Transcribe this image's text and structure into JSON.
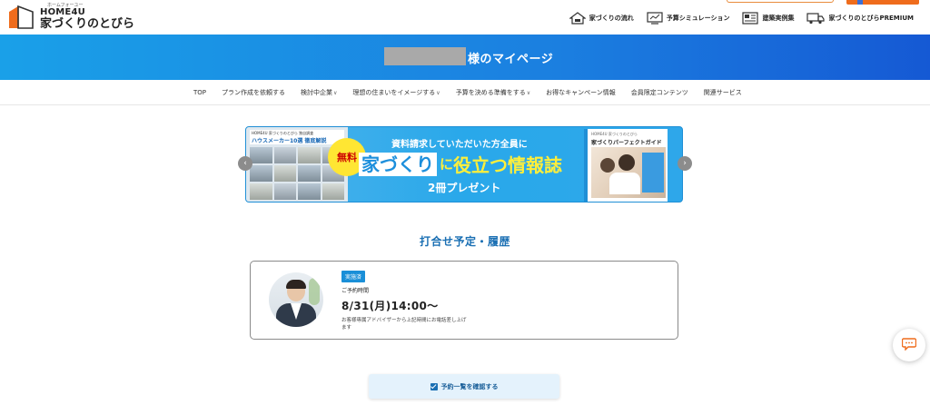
{
  "header": {
    "logo": {
      "ruby": "ホームフォーユー",
      "brand": "HOME4U",
      "name": "家づくりのとびら"
    },
    "nav": [
      {
        "label": "家づくりの流れ",
        "icon": "house-icon"
      },
      {
        "label": "予算シミュレーション",
        "icon": "monitor-icon"
      },
      {
        "label": "建築実例集",
        "icon": "catalog-icon"
      },
      {
        "label": "家づくりのとびらPREMIUM",
        "icon": "truck-icon"
      }
    ]
  },
  "hero": {
    "title_suffix": "様のマイページ"
  },
  "subnav": [
    {
      "label": "TOP",
      "chevron": ""
    },
    {
      "label": "プラン作成を依頼する",
      "chevron": ""
    },
    {
      "label": "検討中企業",
      "chevron": "∨"
    },
    {
      "label": "理想の住まいをイメージする",
      "chevron": "∨"
    },
    {
      "label": "予算を決める準備をする",
      "chevron": "∨"
    },
    {
      "label": "お得なキャンペーン情報",
      "chevron": ""
    },
    {
      "label": "会員限定コンテンツ",
      "chevron": ""
    },
    {
      "label": "関連サービス",
      "chevron": ""
    }
  ],
  "banner": {
    "left_small": "HOME4U 家づくりのとびら 独自調査",
    "left_title": "ハウスメーカー10選 徹底解説",
    "badge": "無料",
    "line1": "資料請求していただいた方全員に",
    "line2a": "家づくり",
    "line2b": "に",
    "line2c": "役立つ情報誌",
    "line3": "2冊プレゼント",
    "book_brand": "HOME4U 家づくりのとびら",
    "book_title": "家づくりパーフェクトガイド"
  },
  "section": {
    "title": "打合せ予定・履歴"
  },
  "appointment": {
    "status": "実施済",
    "label": "ご予約時間",
    "time": "8/31(月)14:00〜",
    "note": "お客様専属アドバイザーから上記時間にお電話差し上げます"
  },
  "button": {
    "label": "予約一覧を確認する"
  },
  "colors": {
    "primary": "#1a8fd8",
    "accent": "#ef6c1c",
    "heading": "#1a6fb3"
  }
}
